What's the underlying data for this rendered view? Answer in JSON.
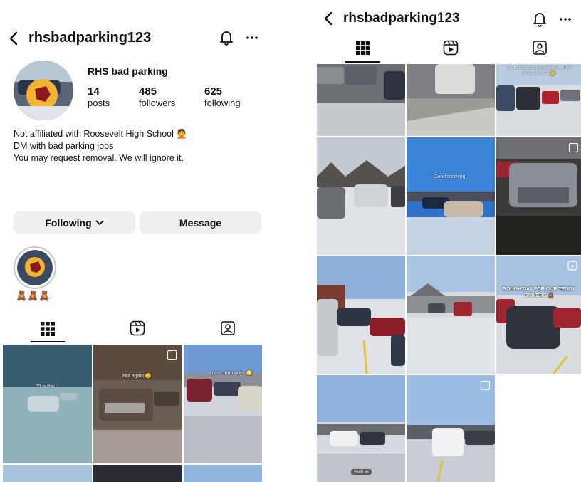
{
  "left": {
    "header": {
      "username": "rhsbadparking123"
    },
    "profile": {
      "display_name": "RHS bad parking",
      "stats": [
        {
          "count": "14",
          "label": "posts"
        },
        {
          "count": "485",
          "label": "followers"
        },
        {
          "count": "625",
          "label": "following"
        }
      ],
      "bio_lines": [
        "Not affiliated with Roosevelt High School 🙅",
        "DM with bad parking jobs",
        "You may request removal. We will ignore it."
      ]
    },
    "buttons": {
      "following": "Following",
      "message": "Message"
    },
    "highlight": {
      "caption": "🧸🧸🧸"
    },
    "grid_captions": [
      "Tf is this",
      "Not again 😕",
      "Like c'mon guys 🙄"
    ]
  },
  "right": {
    "header": {
      "username": "rhsbadparking123"
    },
    "grid_captions": [
      "It's that hard to see how far in the other cars are 😕",
      "Good morning",
      "ROUGH DAY FOR OUR TEDDY DRIVERS 🧸",
      "yeah ok"
    ]
  },
  "colors": {
    "text": "#111111",
    "button_bg": "#efeff1",
    "sky": "#8fb3dc",
    "snow": "#d9dde3"
  }
}
